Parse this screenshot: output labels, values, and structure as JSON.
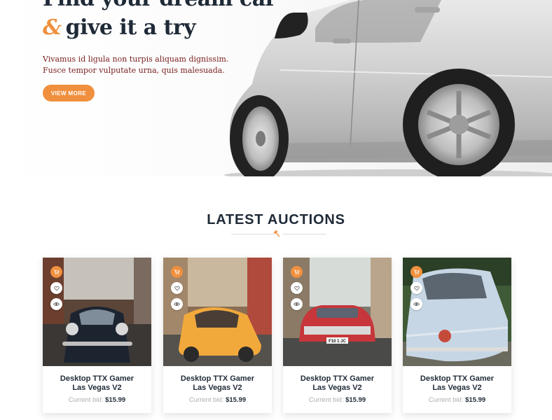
{
  "hero": {
    "title_line1": "Find your dream car",
    "title_amp": "&",
    "title_line2": "give it a try",
    "text_line1": "Vivamus id ligula non turpis aliquam dignissim.",
    "text_line2": "Fusce tempor vulputate urna, quis malesuada.",
    "button_label": "VIEW MORE"
  },
  "section": {
    "title": "LATEST AUCTIONS",
    "divider_icon": "gavel-icon"
  },
  "colors": {
    "accent": "#f0903e",
    "heading": "#1f2a37",
    "hero_text": "#7b2020",
    "muted": "#a9adb3"
  },
  "auctions": [
    {
      "name_line1": "Desktop TTX Gamer",
      "name_line2": "Las Vegas V2",
      "bid_label": "Current bid:",
      "bid_price": "$15.99",
      "icons": [
        "cart-icon",
        "heart-icon",
        "eye-icon"
      ]
    },
    {
      "name_line1": "Desktop TTX Gamer",
      "name_line2": "Las Vegas V2",
      "bid_label": "Current bid:",
      "bid_price": "$15.99",
      "icons": [
        "cart-icon",
        "heart-icon",
        "eye-icon"
      ]
    },
    {
      "name_line1": "Desktop TTX Gamer",
      "name_line2": "Las Vegas V2",
      "bid_label": "Current bid:",
      "bid_price": "$15.99",
      "plate": "F10 1 JC",
      "icons": [
        "cart-icon",
        "heart-icon",
        "eye-icon"
      ]
    },
    {
      "name_line1": "Desktop TTX Gamer",
      "name_line2": "Las Vegas V2",
      "bid_label": "Current bid:",
      "bid_price": "$15.99",
      "icons": [
        "cart-icon",
        "heart-icon",
        "eye-icon"
      ]
    }
  ]
}
